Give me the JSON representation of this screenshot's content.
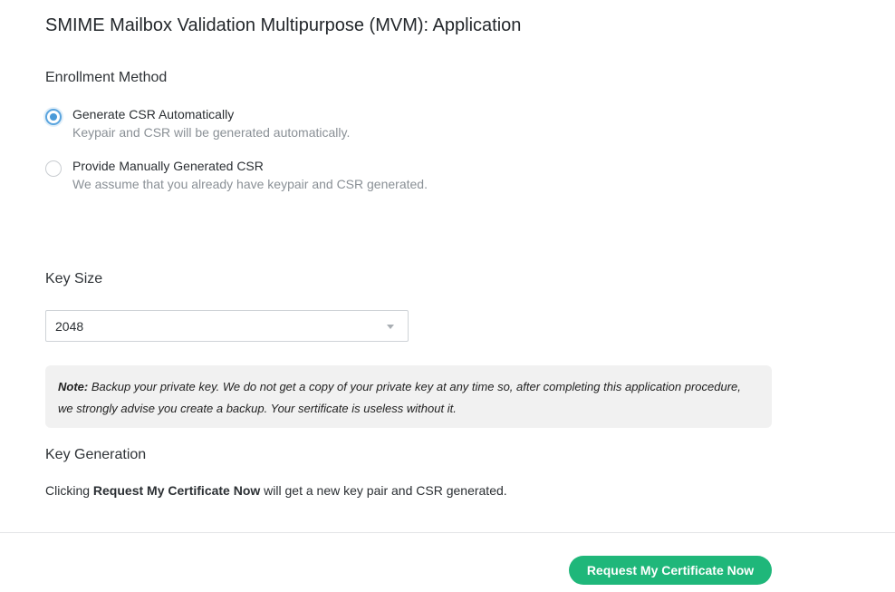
{
  "page": {
    "title": "SMIME Mailbox Validation Multipurpose (MVM): Application"
  },
  "enrollment": {
    "heading": "Enrollment Method",
    "options": [
      {
        "label": "Generate CSR Automatically",
        "description": "Keypair and CSR will be generated automatically.",
        "selected": true
      },
      {
        "label": "Provide Manually Generated CSR",
        "description": "We assume that you already have keypair and CSR generated.",
        "selected": false
      }
    ]
  },
  "key_size": {
    "heading": "Key Size",
    "selected_value": "2048"
  },
  "note": {
    "prefix": "Note:",
    "text": " Backup your private key. We do not get a copy of your private key at any time so, after completing this application procedure, we strongly advise you create a backup. Your sertificate is useless without it."
  },
  "key_generation": {
    "heading": "Key Generation",
    "text_before": "Clicking ",
    "text_bold": "Request My Certificate Now",
    "text_after": " will get a new key pair and CSR generated."
  },
  "actions": {
    "request_label": "Request My Certificate Now"
  },
  "colors": {
    "accent_button": "#1fb77a",
    "radio_selected": "#4a9ad8",
    "note_background": "#f1f1f1"
  },
  "icons": {
    "select_caret": "caret-down-icon"
  }
}
